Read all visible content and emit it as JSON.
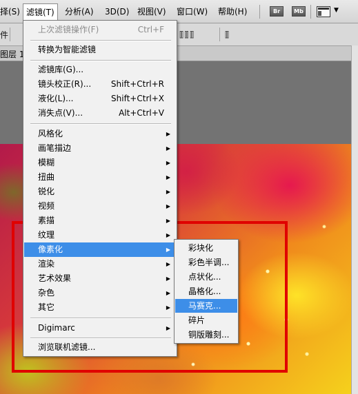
{
  "menubar": {
    "items": [
      "择(S)",
      "滤镜(T)",
      "分析(A)",
      "3D(D)",
      "视图(V)",
      "窗口(W)",
      "帮助(H)"
    ],
    "badges": [
      "Br",
      "Mb"
    ],
    "layout_dropdown_caret": "▼"
  },
  "optbar": {
    "left_text": "件"
  },
  "tabbar": {
    "doc_tab": "图层 1"
  },
  "filter_menu": {
    "last_filter": {
      "label": "上次滤镜操作(F)",
      "shortcut": "Ctrl+F"
    },
    "smart": "转换为智能滤镜",
    "group1": [
      {
        "label": "滤镜库(G)...",
        "shortcut": ""
      },
      {
        "label": "镜头校正(R)...",
        "shortcut": "Shift+Ctrl+R"
      },
      {
        "label": "液化(L)...",
        "shortcut": "Shift+Ctrl+X"
      },
      {
        "label": "消失点(V)...",
        "shortcut": "Alt+Ctrl+V"
      }
    ],
    "submenus": [
      "风格化",
      "画笔描边",
      "模糊",
      "扭曲",
      "锐化",
      "视频",
      "素描",
      "纹理",
      "像素化",
      "渲染",
      "艺术效果",
      "杂色",
      "其它"
    ],
    "digimarc": "Digimarc",
    "browse": "浏览联机滤镜...",
    "submenu_arrow": "▶"
  },
  "pixelate_submenu": {
    "items": [
      "彩块化",
      "彩色半调...",
      "点状化...",
      "晶格化...",
      "马赛克...",
      "碎片",
      "铜版雕刻..."
    ],
    "highlighted": "马赛克..."
  },
  "colors": {
    "menu_highlight": "#3d8ee8",
    "annotation_box": "#e00000"
  }
}
